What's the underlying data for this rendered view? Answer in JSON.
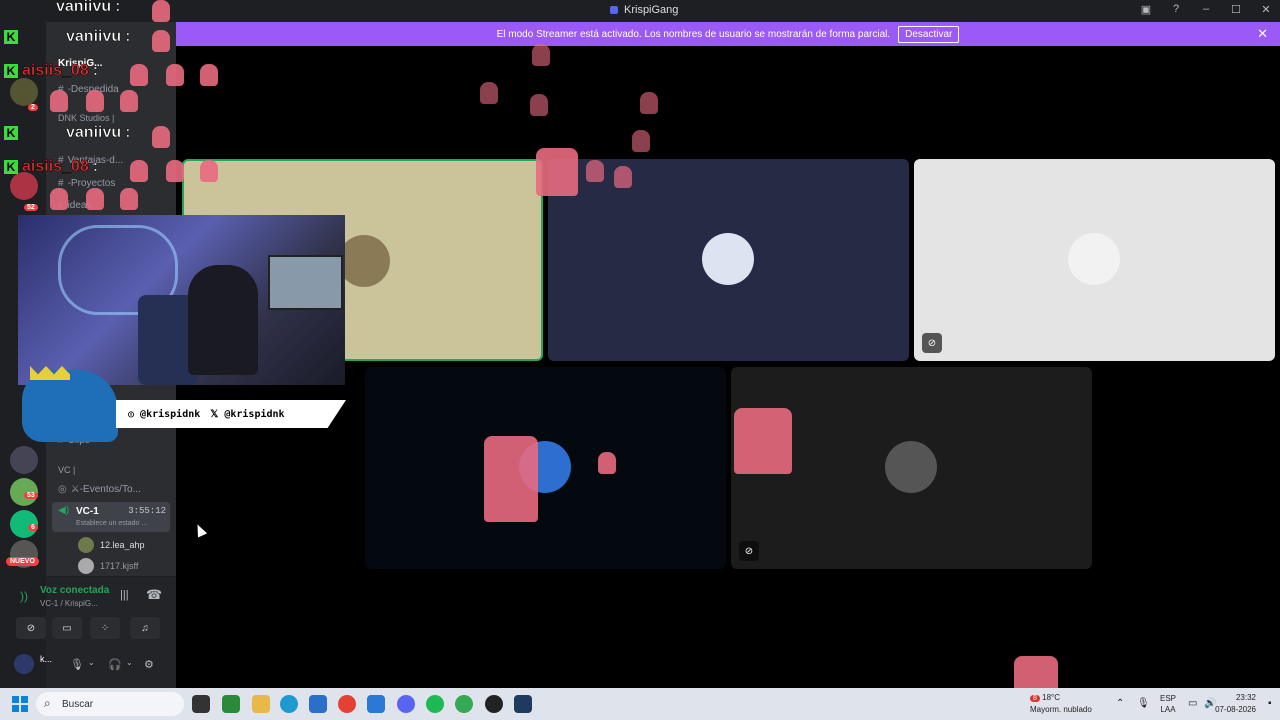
{
  "window": {
    "title": "KrispiGang"
  },
  "banner": {
    "message": "El modo Streamer está activado. Los nombres de usuario se mostrarán de forma parcial.",
    "button": "Desactivar"
  },
  "sidebar": {
    "server_name": "KrispiG...",
    "channels": [
      {
        "label": "-Despedida"
      },
      {
        "label": "Ventajas-d..."
      },
      {
        "label": "-Proyectos"
      },
      {
        "label": "ideas"
      },
      {
        "label": "Clips"
      }
    ],
    "category_dnk": "DNK Studios |",
    "category_vc": "VC |",
    "event_channel": "⚔-Eventos/To...",
    "vc_channel": {
      "name": "VC-1",
      "time": "3:55:12",
      "status": "Establece un estado ..."
    },
    "vc_users": [
      {
        "name": "12.lea_ahp"
      },
      {
        "name": "1717.kjsff"
      }
    ],
    "voice": {
      "connected": "Voz conectada",
      "where": "VC-1 / KrispiG..."
    },
    "user": {
      "name": "k..."
    },
    "nuevo": "NUEVO",
    "badges": [
      "2",
      "52",
      "53",
      "6"
    ]
  },
  "overlay": {
    "chat": [
      {
        "user": "vaniivu",
        "sep": ":"
      },
      {
        "user": "vaniivu",
        "sep": ":"
      },
      {
        "user": "aisiis_08",
        "sep": ":"
      },
      {
        "user": "vaniivu",
        "sep": ":"
      },
      {
        "user": "aisiis_08",
        "sep": ":"
      }
    ],
    "socials": [
      "@krispidnk",
      "@krispidnk"
    ]
  },
  "taskbar": {
    "search": "Buscar",
    "weather_temp": "18°C",
    "weather_desc": "Mayorm. nublado",
    "lang_1": "ESP",
    "lang_2": "LAA",
    "time": "23:32",
    "date": "07-08-2026",
    "weather_badge": "8"
  },
  "colors": {
    "banner": "#9b59f6",
    "accent_green": "#23a55a",
    "danger": "#f23f42"
  }
}
